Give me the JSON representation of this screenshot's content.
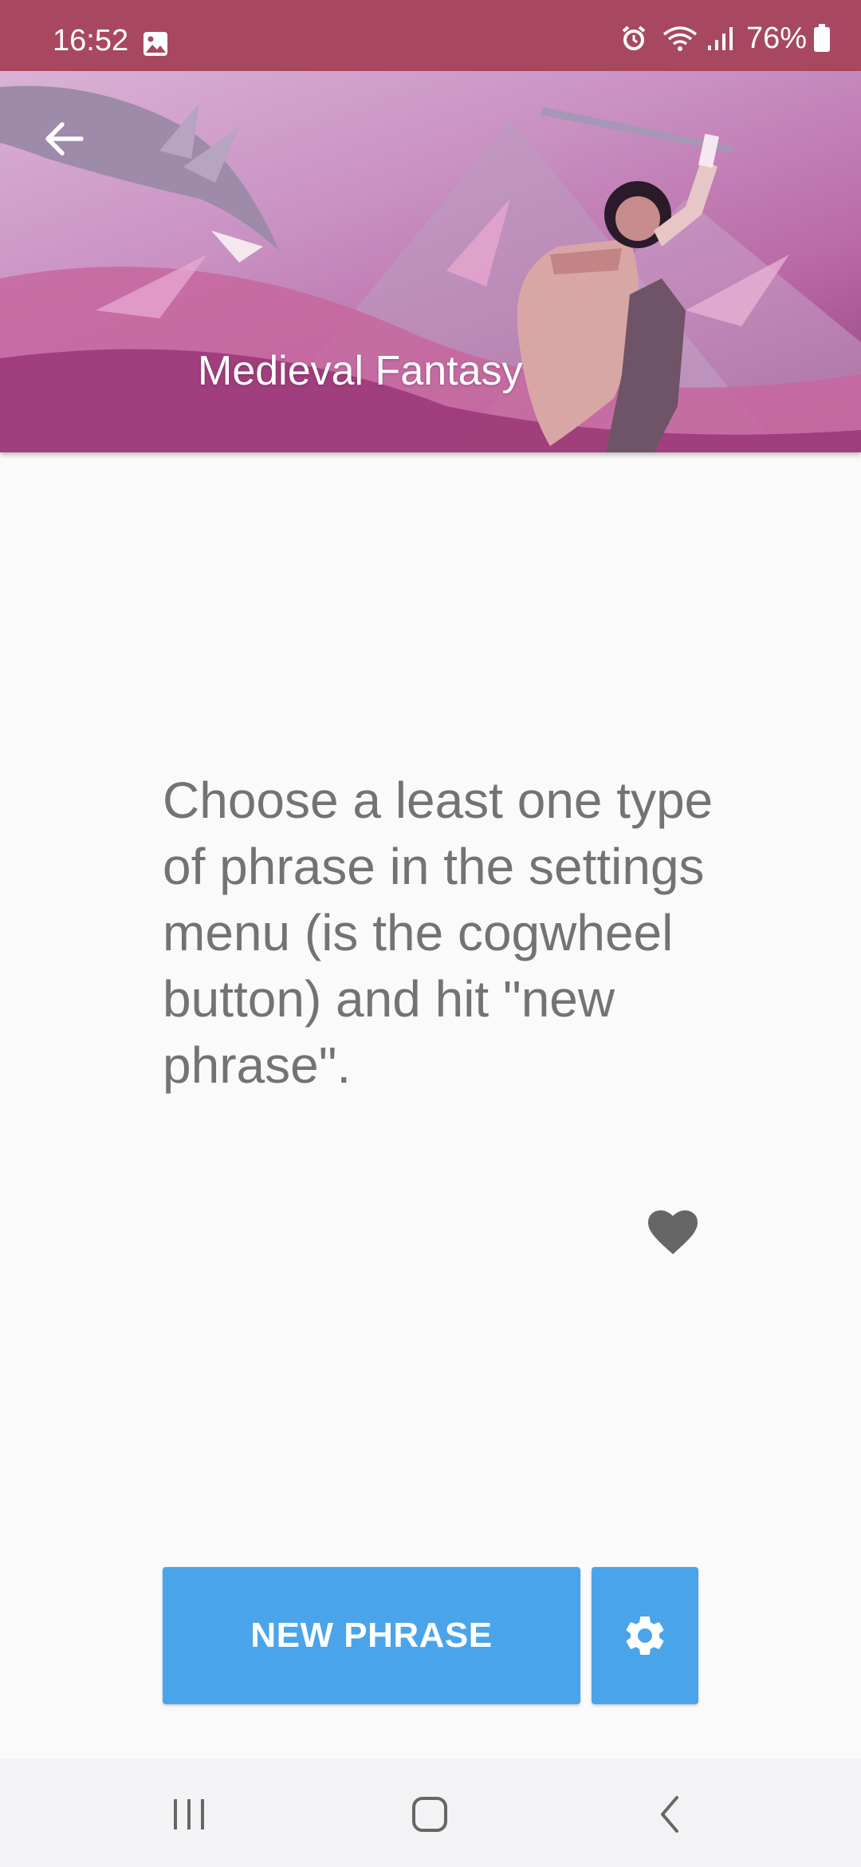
{
  "status_bar": {
    "time": "16:52",
    "battery": "76%",
    "icons": [
      "gallery-icon",
      "alarm-icon",
      "wifi-icon",
      "signal-icon",
      "battery-icon"
    ]
  },
  "header": {
    "title": "Medieval Fantasy",
    "back_icon": "back-arrow-icon",
    "image": "fantasy-warrior-dragon-illustration"
  },
  "main": {
    "phrase": "Choose a least one type of phrase in the settings menu (is the cogwheel button) and hit \"new phrase\".",
    "favorite_icon": "heart-icon"
  },
  "actions": {
    "new_phrase_label": "NEW PHRASE",
    "settings_icon": "gear-icon"
  },
  "nav_bar": {
    "icons": [
      "recent-apps-icon",
      "home-icon",
      "back-icon"
    ]
  },
  "colors": {
    "status_bar": "#a84860",
    "accent_button": "#4aa4ea",
    "phrase_text": "#737373",
    "background": "#fafafa"
  }
}
